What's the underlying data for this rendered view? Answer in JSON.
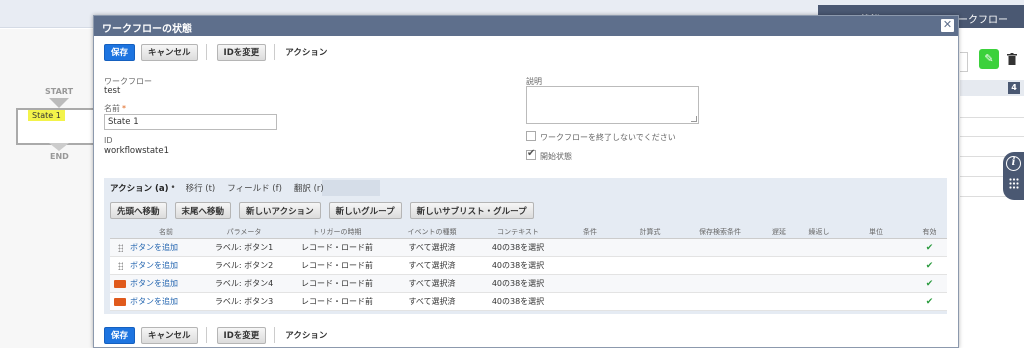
{
  "background": {
    "tabs": [
      "状態",
      "ワークフロー"
    ],
    "workflow": {
      "start": "START",
      "state": "State 1",
      "end": "END"
    },
    "badge": "4"
  },
  "modal": {
    "title": "ワークフローの状態",
    "toolbar": {
      "save": "保存",
      "cancel": "キャンセル",
      "change_id": "IDを変更",
      "actions": "アクション"
    },
    "fields": {
      "workflow_label": "ワークフロー",
      "workflow_value": "test",
      "name_label": "名前",
      "name_value": "State 1",
      "id_label": "ID",
      "id_value": "workflowstate1",
      "description_label": "説明",
      "dont_exit_label": "ワークフローを終了しないでください",
      "initial_state_label": "開始状態"
    },
    "sublist": {
      "tabs": [
        "アクション (a)",
        "移行 (t)",
        "フィールド (f)",
        "翻訳 (r)"
      ],
      "tab_dot": "•",
      "buttons": [
        "先頭へ移動",
        "末尾へ移動",
        "新しいアクション",
        "新しいグループ",
        "新しいサブリスト・グループ"
      ],
      "columns": [
        "名前",
        "パラメータ",
        "トリガーの時期",
        "イベントの種類",
        "コンテキスト",
        "条件",
        "計算式",
        "保存検索条件",
        "遅延",
        "繰返し",
        "単位",
        "有効"
      ],
      "rows": [
        {
          "name": "ボタンを追加",
          "param": "ラベル: ボタン1",
          "trigger": "レコード・ロード前",
          "event": "すべて選択済",
          "context": "40の38を選択"
        },
        {
          "name": "ボタンを追加",
          "param": "ラベル: ボタン2",
          "trigger": "レコード・ロード前",
          "event": "すべて選択済",
          "context": "40の38を選択"
        },
        {
          "name": "ボタンを追加",
          "param": "ラベル: ボタン4",
          "trigger": "レコード・ロード前",
          "event": "すべて選択済",
          "context": "40の38を選択"
        },
        {
          "name": "ボタンを追加",
          "param": "ラベル: ボタン3",
          "trigger": "レコード・ロード前",
          "event": "すべて選択済",
          "context": "40の38を選択"
        }
      ]
    }
  }
}
